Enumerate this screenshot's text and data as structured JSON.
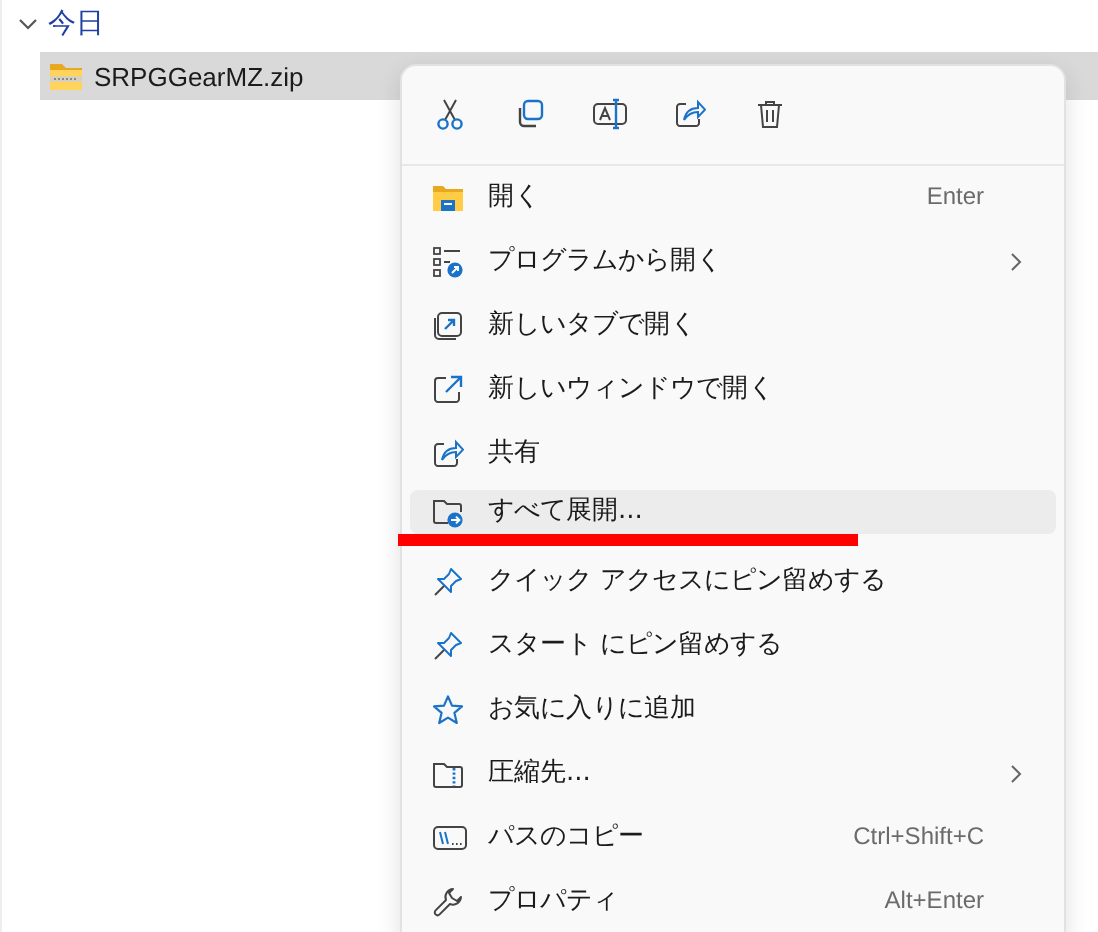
{
  "group": {
    "label": "今日",
    "expanded": true
  },
  "file": {
    "name": "SRPGGearMZ.zip",
    "selected": true
  },
  "context_menu": {
    "items": [
      {
        "label": "開く",
        "shortcut": "Enter",
        "submenu": false,
        "selected": false
      },
      {
        "label": "プログラムから開く",
        "submenu": true,
        "selected": false
      },
      {
        "label": "新しいタブで開く",
        "submenu": false,
        "selected": false
      },
      {
        "label": "新しいウィンドウで開く",
        "submenu": false,
        "selected": false
      },
      {
        "label": "共有",
        "submenu": false,
        "selected": false
      },
      {
        "label": "すべて展開...",
        "submenu": false,
        "selected": true
      },
      {
        "label": "クイック アクセスにピン留めする",
        "submenu": false,
        "selected": false
      },
      {
        "label": "スタート にピン留めする",
        "submenu": false,
        "selected": false
      },
      {
        "label": "お気に入りに追加",
        "submenu": false,
        "selected": false
      },
      {
        "label": "圧縮先...",
        "submenu": true,
        "selected": false
      },
      {
        "label": "パスのコピー",
        "shortcut": "Ctrl+Shift+C",
        "submenu": false,
        "selected": false
      },
      {
        "label": "プロパティ",
        "shortcut": "Alt+Enter",
        "submenu": false,
        "selected": false
      }
    ]
  },
  "annotation": {
    "kind": "underline"
  }
}
